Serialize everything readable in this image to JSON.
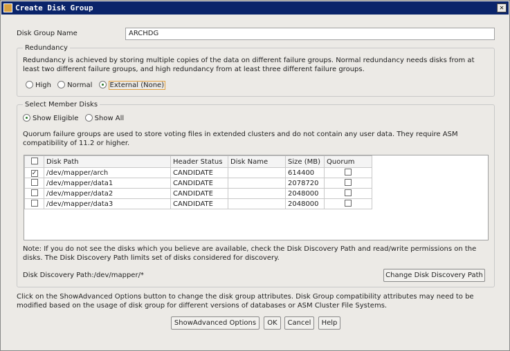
{
  "title": "Create Disk Group",
  "name_label": "Disk Group Name",
  "name_value": "ARCHDG",
  "redundancy": {
    "legend": "Redundancy",
    "desc": "Redundancy is achieved by storing multiple copies of the data on different failure groups. Normal redundancy needs disks from at least two different failure groups, and high redundancy from at least three different failure groups.",
    "options": [
      "High",
      "Normal",
      "External (None)"
    ],
    "selected": 2
  },
  "members": {
    "legend": "Select Member Disks",
    "show_eligible": "Show Eligible",
    "show_all": "Show All",
    "quorum_note": "Quorum failure groups are used to store voting files in extended clusters and do not contain any user data. They require ASM compatibility of 11.2 or higher.",
    "columns": [
      "Disk Path",
      "Header Status",
      "Disk Name",
      "Size (MB)",
      "Quorum"
    ],
    "rows": [
      {
        "checked": true,
        "path": "/dev/mapper/arch",
        "status": "CANDIDATE",
        "name": "",
        "size": "614400"
      },
      {
        "checked": false,
        "path": "/dev/mapper/data1",
        "status": "CANDIDATE",
        "name": "",
        "size": "2078720"
      },
      {
        "checked": false,
        "path": "/dev/mapper/data2",
        "status": "CANDIDATE",
        "name": "",
        "size": "2048000"
      },
      {
        "checked": false,
        "path": "/dev/mapper/data3",
        "status": "CANDIDATE",
        "name": "",
        "size": "2048000"
      }
    ],
    "note": "Note: If you do not see the disks which you believe are available, check the Disk Discovery Path and read/write permissions on the disks. The Disk Discovery Path limits set of disks considered for discovery.",
    "discovery_path": "Disk Discovery Path:/dev/mapper/*",
    "change_path": "Change Disk Discovery Path"
  },
  "footer_note": "Click on the ShowAdvanced Options button to change the disk group attributes. Disk Group compatibility attributes may need to be modified based on the usage of disk group for different versions of databases or ASM Cluster File Systems.",
  "buttons": {
    "advanced": "ShowAdvanced Options",
    "ok": "OK",
    "cancel": "Cancel",
    "help": "Help"
  }
}
